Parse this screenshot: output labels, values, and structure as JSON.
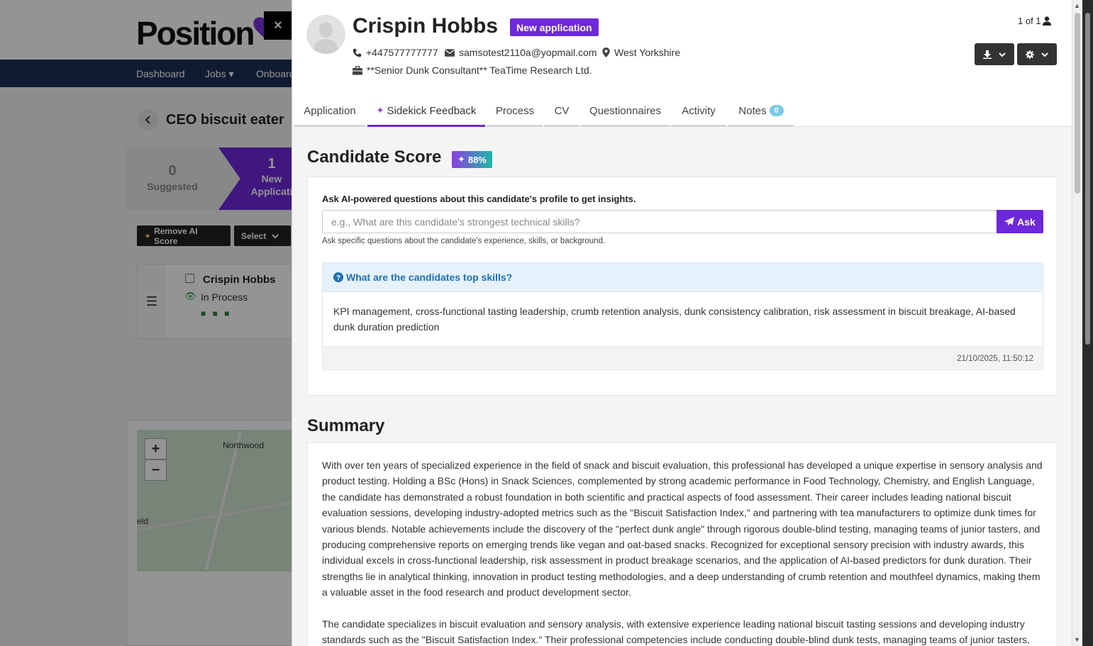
{
  "background": {
    "logo": "Position",
    "close_label": "×",
    "nav": [
      "Dashboard",
      "Jobs ▾",
      "Onboard"
    ],
    "job_title": "CEO biscuit eater",
    "stages": [
      {
        "count": "0",
        "label": "Suggested"
      },
      {
        "count": "1",
        "label": "New Applicati"
      }
    ],
    "remove_ai_score_label": "Remove AI Score",
    "select_label": "Select",
    "card": {
      "name": "Crispin Hobbs",
      "status": "In Process",
      "dots": "■ ■ ■"
    },
    "map": {
      "place_label": "Northwood",
      "place_label_2": "eld",
      "zoom_in": "+",
      "zoom_out": "−"
    }
  },
  "candidate": {
    "name": "Crispin Hobbs",
    "status_badge": "New application",
    "phone": "+447577777777",
    "email": "samsotest2110a@yopmail.com",
    "location": "West Yorkshire",
    "job": "**Senior Dunk Consultant** TeaTime Research Ltd.",
    "pager": "1 of 1"
  },
  "tabs": [
    {
      "label": "Application"
    },
    {
      "label": "Sidekick Feedback",
      "active": true
    },
    {
      "label": "Process"
    },
    {
      "label": "CV"
    },
    {
      "label": "Questionnaires"
    },
    {
      "label": "Activity"
    },
    {
      "label": "Notes",
      "count": "0"
    }
  ],
  "score": {
    "title": "Candidate Score",
    "value": "88%",
    "ask_label": "Ask AI-powered questions about this candidate's profile to get insights.",
    "ask_placeholder": "e.g., What are this candidate's strongest technical skills?",
    "ask_button": "Ask",
    "ask_help": "Ask specific questions about the candidate's experience, skills, or background.",
    "qa": {
      "question": "What are the candidates top skills?",
      "answer": "KPI management, cross-functional tasting leadership, crumb retention analysis, dunk consistency calibration, risk assessment in biscuit breakage, AI-based dunk duration prediction",
      "timestamp": "21/10/2025, 11:50:12"
    }
  },
  "summary": {
    "title": "Summary",
    "paragraphs": [
      "With over ten years of specialized experience in the field of snack and biscuit evaluation, this professional has developed a unique expertise in sensory analysis and product testing. Holding a BSc (Hons) in Snack Sciences, complemented by strong academic performance in Food Technology, Chemistry, and English Language, the candidate has demonstrated a robust foundation in both scientific and practical aspects of food assessment. Their career includes leading national biscuit evaluation sessions, developing industry-adopted metrics such as the \"Biscuit Satisfaction Index,\" and partnering with tea manufacturers to optimize dunk times for various blends. Notable achievements include the discovery of the \"perfect dunk angle\" through rigorous double-blind testing, managing teams of junior tasters, and producing comprehensive reports on emerging trends like vegan and oat-based snacks. Recognized for exceptional sensory precision with industry awards, this individual excels in cross-functional leadership, risk assessment in product breakage scenarios, and the application of AI-based predictors for dunk duration. Their strengths lie in analytical thinking, innovation in product testing methodologies, and a deep understanding of crumb retention and mouthfeel dynamics, making them a valuable asset in the food research and product development sector.",
      "The candidate specializes in biscuit evaluation and sensory analysis, with extensive experience leading national biscuit tasting sessions and developing industry standards such as the \"Biscuit Satisfaction Index.\" Their professional competencies include conducting double-blind dunk tests, managing teams of junior tasters,"
    ]
  },
  "colors": {
    "accent": "#6d28d9",
    "nav_bg": "#1b2f55",
    "question": "#1f6fb2"
  }
}
